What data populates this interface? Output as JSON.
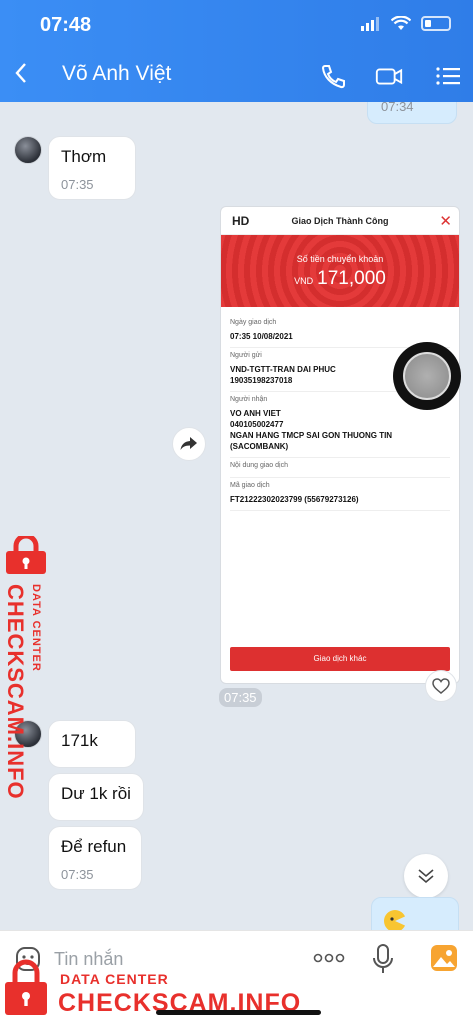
{
  "status_bar": {
    "time": "07:48"
  },
  "header": {
    "title": "Võ Anh Việt"
  },
  "messages": {
    "prev_sent_time": "07:34",
    "m1_text": "Thơm",
    "m1_time": "07:35",
    "image_time": "07:35",
    "m2_text": "171k",
    "m3_text": "Dư 1k rồi",
    "m4_text": "Để refun",
    "m4_time": "07:35"
  },
  "receipt": {
    "badge": "HD",
    "title": "Giao Dịch Thành Công",
    "amount_label": "Số tiền chuyển khoản",
    "currency": "VND",
    "amount": "171,000",
    "date_label": "Ngày giao dịch",
    "date_value": "07:35 10/08/2021",
    "sender_label": "Người gửi",
    "sender_value": "VND-TGTT-TRAN DAI PHUC\n19035198237018",
    "receiver_label": "Người nhận",
    "receiver_value": "VO ANH VIET\n040105002477\nNGAN HANG TMCP SAI GON THUONG TIN\n(SACOMBANK)",
    "content_label": "Nội dung giao dịch",
    "code_label": "Mã giao dịch",
    "code_value": "FT21222302023799 (55679273126)",
    "button": "Giao dịch khác"
  },
  "input": {
    "placeholder": "Tin nhắn"
  },
  "watermark": {
    "small": "DATA CENTER",
    "big": "CHECKSCAM.INFO"
  },
  "colors": {
    "header": "#3187f0",
    "accent_red": "#e8302c",
    "receipt_red": "#dd3030"
  }
}
